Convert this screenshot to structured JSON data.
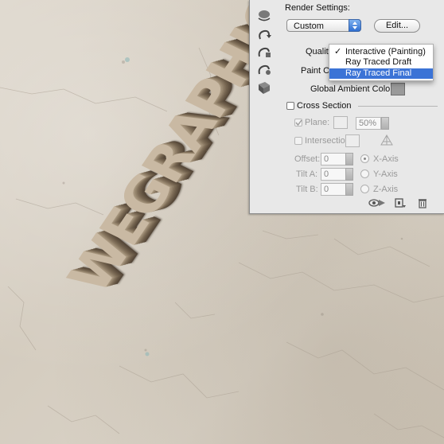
{
  "canvas": {
    "text": "WEGRAPHICS"
  },
  "tools": [
    {
      "name": "rotate-3d-object-icon"
    },
    {
      "name": "roll-3d-object-icon"
    },
    {
      "name": "drag-3d-object-icon"
    },
    {
      "name": "slide-3d-object-icon"
    },
    {
      "name": "scale-3d-object-icon"
    }
  ],
  "panel": {
    "render_settings_label": "Render Settings:",
    "preset_value": "Custom",
    "edit_button": "Edit...",
    "quality_label": "Quality",
    "paint_on_label": "Paint O",
    "global_ambient_label": "Global Ambient Color:",
    "quality_menu": {
      "items": [
        "Interactive (Painting)",
        "Ray Traced Draft",
        "Ray Traced Final"
      ],
      "checked_index": 0,
      "highlighted_index": 2
    },
    "cross_section": {
      "label": "Cross Section",
      "checked": false,
      "plane_label": "Plane:",
      "plane_checked": true,
      "opacity_value": "50%",
      "intersection_label": "Intersection:",
      "offset_label": "Offset:",
      "offset_value": "0",
      "tilt_a_label": "Tilt A:",
      "tilt_a_value": "0",
      "tilt_b_label": "Tilt B:",
      "tilt_b_value": "0",
      "axis_options": [
        "X-Axis",
        "Y-Axis",
        "Z-Axis"
      ],
      "axis_selected": "X-Axis"
    }
  },
  "colors": {
    "panel_bg": "#e8e8e8",
    "highlight": "#3b73d6",
    "ambient_swatch": "#9a9a9a",
    "extrusion_text": "#c9b9a3"
  }
}
